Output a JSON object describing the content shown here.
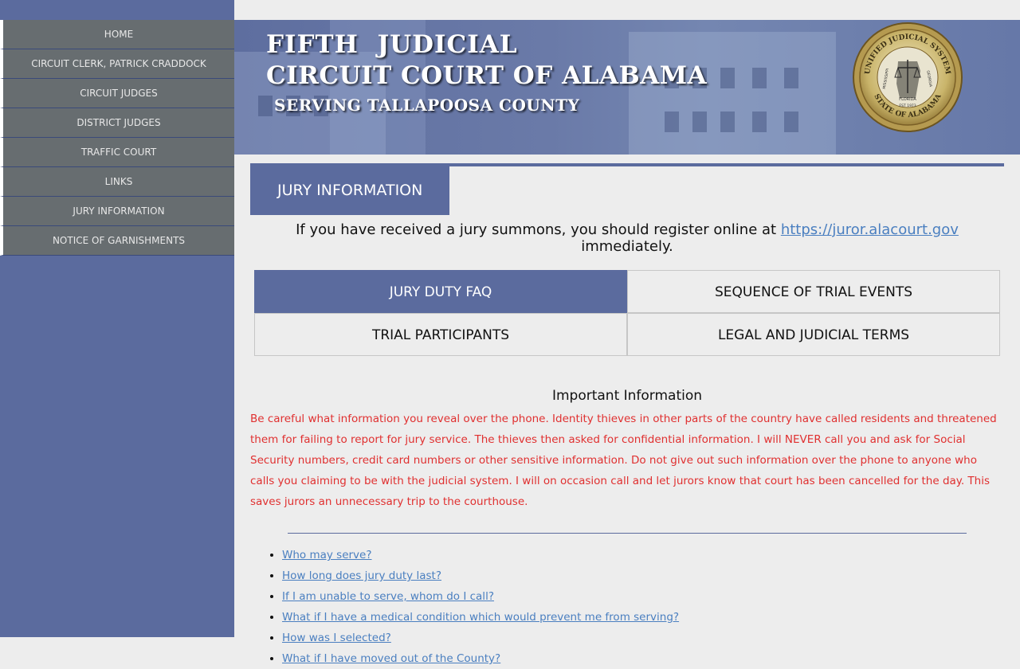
{
  "nav": {
    "items": [
      {
        "label": "HOME"
      },
      {
        "label": "CIRCUIT CLERK, PATRICK CRADDOCK"
      },
      {
        "label": "CIRCUIT JUDGES"
      },
      {
        "label": "DISTRICT JUDGES"
      },
      {
        "label": "TRAFFIC COURT"
      },
      {
        "label": "LINKS"
      },
      {
        "label": "JURY INFORMATION"
      },
      {
        "label": "NOTICE OF GARNISHMENTS"
      }
    ]
  },
  "banner": {
    "line1": "FIFTH  JUDICIAL",
    "line2": "CIRCUIT COURT OF ALABAMA",
    "line3": "SERVING TALLAPOOSA COUNTY",
    "seal_top": "UNIFIED JUDICIAL SYSTEM",
    "seal_bottom": "STATE OF ALABAMA",
    "seal_center": "FLORIDA",
    "seal_left": "MISSISSIPPI",
    "seal_right": "GEORGIA",
    "seal_est": "EST 1973"
  },
  "page": {
    "tab_label": "JURY INFORMATION",
    "intro_before": "If you have received a jury summons, you should register online at ",
    "intro_link": "https://juror.alacourt.gov",
    "intro_after": " immediately."
  },
  "tabs": [
    {
      "label": "JURY DUTY FAQ",
      "active": true
    },
    {
      "label": "SEQUENCE OF TRIAL EVENTS",
      "active": false
    },
    {
      "label": "TRIAL PARTICIPANTS",
      "active": false
    },
    {
      "label": "LEGAL AND JUDICIAL TERMS",
      "active": false
    }
  ],
  "important": {
    "title": "Important Information",
    "text": "Be careful what information you reveal over the phone. Identity thieves in other parts of the country have called residents and threatened them for failing to report for jury service. The thieves then asked for confidential information. I will NEVER call you and ask for Social Security numbers, credit card numbers or other sensitive information. Do not give out such information over the phone to anyone who calls you claiming to be with the judicial system. I will on occasion call and let jurors know that court has been cancelled for the day. This saves jurors an unnecessary trip to the courthouse."
  },
  "faq": [
    {
      "label": "Who may serve?"
    },
    {
      "label": "How long does jury duty last?"
    },
    {
      "label": "If I am unable to serve, whom do I call?"
    },
    {
      "label": "What if I have a medical condition which would prevent me from serving?"
    },
    {
      "label": "How was I selected?"
    },
    {
      "label": "What if I have moved out of the County?"
    }
  ],
  "colors": {
    "accent": "#5b6b9e",
    "nav_item_bg": "#676d70",
    "warning": "#e03030",
    "link": "#4a7fc0"
  }
}
